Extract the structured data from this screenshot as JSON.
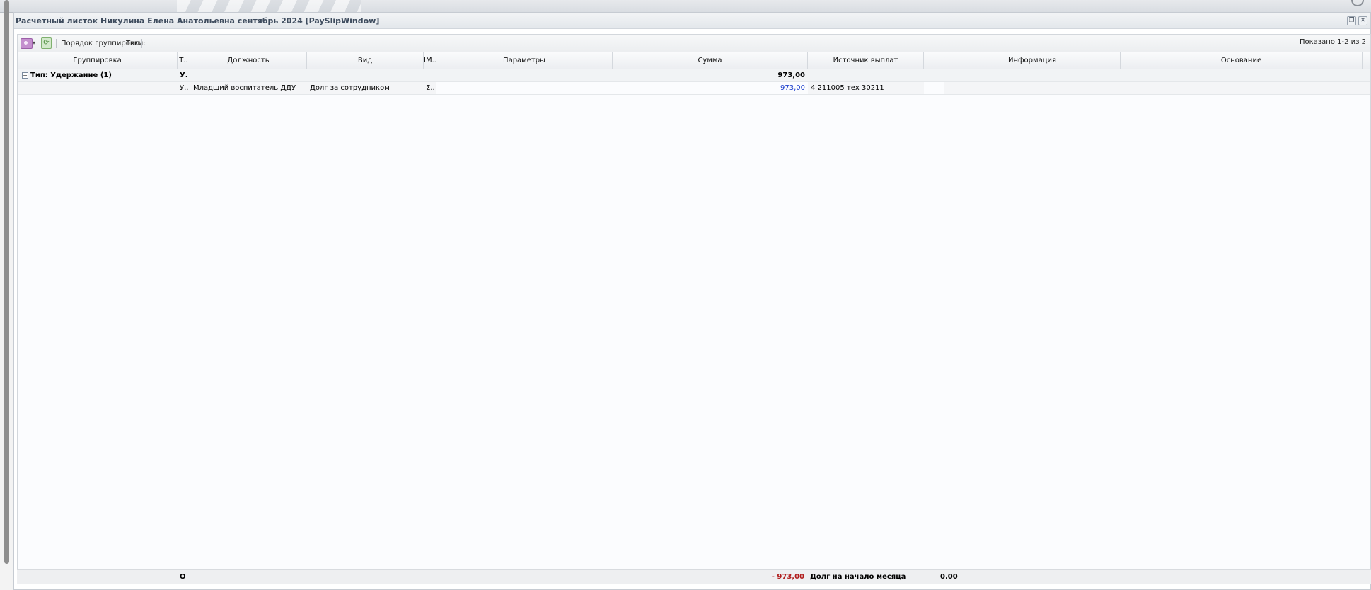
{
  "window": {
    "title": "Расчетный листок Никулина Елена Анатольевна сентябрь 2024 [PaySlipWindow]"
  },
  "toolbar": {
    "grouping_label": "Порядок группировки:",
    "grouping_value": "Тип",
    "shown": "Показано 1-2 из 2"
  },
  "columns": {
    "grouping": "Группировка",
    "type": "Т..",
    "position": "Должность",
    "kind": "Вид",
    "im": "IM..",
    "params": "Параметры",
    "sum": "Сумма",
    "source": "Источник выплат",
    "blank": "",
    "info": "Информация",
    "basis": "Основание"
  },
  "group": {
    "expander": "−",
    "label": "Тип: Удержание (1)",
    "type": "У.",
    "sum": "973,00"
  },
  "row": {
    "type": "У..",
    "position": "Младший воспитатель ДДУ",
    "kind": "Долг за сотрудником",
    "im": "Σ..",
    "params": "",
    "sum": "973,00",
    "source": "4 211005 тех 30211"
  },
  "footer": {
    "label": "О",
    "sum": "- 973,00",
    "debt_label": "Долг на начало месяца",
    "debt_value": "0.00"
  },
  "colors": {
    "negative": "#b01c1c",
    "link": "#1a3ccc",
    "title": "#3e4c5e"
  }
}
